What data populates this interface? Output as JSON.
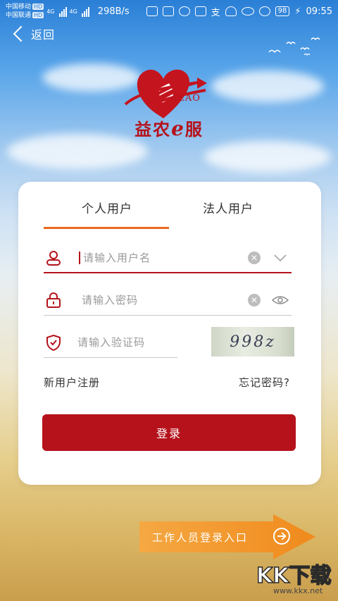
{
  "status_bar": {
    "carrier_1": "中国移动",
    "carrier_2": "中国联通",
    "hd_badge": "HD",
    "net_type_1": "4G",
    "net_type_2": "4G",
    "net_speed": "298B/s",
    "battery": "98",
    "time": "09:55"
  },
  "nav": {
    "back_label": "返回"
  },
  "logo": {
    "sub": "AEAO",
    "title_prefix": "益农",
    "title_e": "e",
    "title_suffix": "服"
  },
  "tabs": [
    {
      "label": "个人用户",
      "active": true
    },
    {
      "label": "法人用户",
      "active": false
    }
  ],
  "form": {
    "username_placeholder": "请输入用户名",
    "password_placeholder": "请输入密码",
    "captcha_placeholder": "请输入验证码",
    "captcha_text": "998z",
    "clear_glyph": "✕"
  },
  "links": {
    "register": "新用户注册",
    "forgot": "忘记密码?"
  },
  "login_button": "登录",
  "staff_entry": "工作人员登录入口",
  "watermark": {
    "text": "KK下载",
    "url": "www.kkx.net"
  },
  "colors": {
    "primary": "#b5121b",
    "accent_tab": "#e96a1e",
    "staff_entry": "#f39a2c"
  }
}
